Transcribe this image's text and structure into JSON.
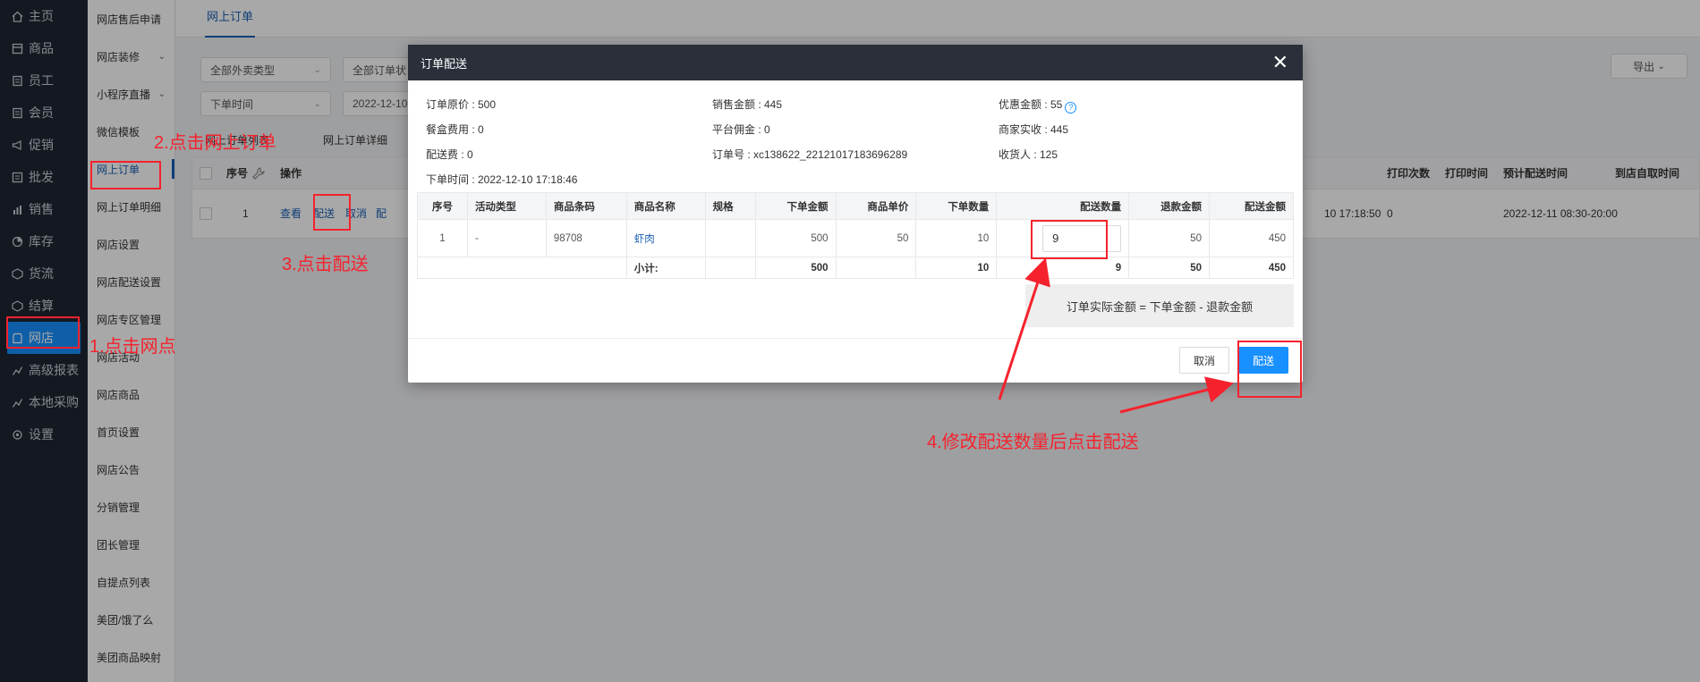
{
  "nav": {
    "items": [
      {
        "label": "主页",
        "icon": "home-icon"
      },
      {
        "label": "商品",
        "icon": "goods-icon"
      },
      {
        "label": "员工",
        "icon": "staff-icon"
      },
      {
        "label": "会员",
        "icon": "member-icon"
      },
      {
        "label": "促销",
        "icon": "promotion-icon"
      },
      {
        "label": "批发",
        "icon": "wholesale-icon"
      },
      {
        "label": "销售",
        "icon": "sales-icon"
      },
      {
        "label": "库存",
        "icon": "stock-icon"
      },
      {
        "label": "货流",
        "icon": "logistics-icon"
      },
      {
        "label": "结算",
        "icon": "settlement-icon"
      },
      {
        "label": "网店",
        "icon": "shop-icon",
        "active": true
      },
      {
        "label": "高级报表",
        "icon": "report-icon"
      },
      {
        "label": "本地采购",
        "icon": "purchase-icon"
      },
      {
        "label": "设置",
        "icon": "settings-icon"
      }
    ]
  },
  "subnav": {
    "items": [
      {
        "label": "网店售后申请"
      },
      {
        "label": "网店装修",
        "chevron": true
      },
      {
        "label": "小程序直播",
        "chevron": true
      },
      {
        "label": "微信模板"
      },
      {
        "label": "网上订单",
        "active": true
      },
      {
        "label": "网上订单明细"
      },
      {
        "label": "网店设置"
      },
      {
        "label": "网店配送设置"
      },
      {
        "label": "网店专区管理"
      },
      {
        "label": "网店活动"
      },
      {
        "label": "网店商品"
      },
      {
        "label": "首页设置"
      },
      {
        "label": "网店公告"
      },
      {
        "label": "分销管理"
      },
      {
        "label": "团长管理"
      },
      {
        "label": "自提点列表"
      },
      {
        "label": "美团/饿了么"
      },
      {
        "label": "美团商品映射"
      }
    ]
  },
  "topbar": {
    "tab": "网上订单"
  },
  "filters": {
    "type": "全部外卖类型",
    "status": "全部订单状",
    "time_field": "下单时间",
    "date": "2022-12-10"
  },
  "export_label": "导出",
  "subtabs": [
    "网上订单列表",
    "网上订单详细"
  ],
  "grid": {
    "headers": {
      "seq": "序号",
      "op": "操作",
      "print_count": "打印次数",
      "print_time": "打印时间",
      "deliver_time": "预计配送时间",
      "pickup_time": "到店自取时间"
    },
    "row": {
      "seq": "1",
      "actions": [
        "查看",
        "配送",
        "取消",
        "配"
      ],
      "time_tail": "10 17:18:50",
      "print_count": "0",
      "deliver_time": "2022-12-11 08:30-20:00"
    }
  },
  "modal": {
    "title": "订单配送",
    "info": {
      "orig_price": "订单原价 : 500",
      "sales_amount": "销售金额 : 445",
      "discount": "优惠金额 : 55",
      "box_fee": "餐盒费用 : 0",
      "platform_fee": "平台佣金 : 0",
      "merchant_income": "商家实收 : 445",
      "delivery_fee": "配送费 : 0",
      "order_no": "订单号 : xc138622_22121017183696289",
      "receiver": "收货人 : 125",
      "order_time": "下单时间 : 2022-12-10 17:18:46"
    },
    "table": {
      "headers": [
        "序号",
        "活动类型",
        "商品条码",
        "商品名称",
        "规格",
        "下单金额",
        "商品单价",
        "下单数量",
        "配送数量",
        "退款金额",
        "配送金额"
      ],
      "row": {
        "seq": "1",
        "activity": "-",
        "barcode": "98708",
        "name": "虾肉",
        "spec": "",
        "order_amount": "500",
        "unit_price": "50",
        "order_qty": "10",
        "deliver_qty": "9",
        "refund": "50",
        "deliver_amount": "450"
      },
      "subtotal": {
        "label": "小计:",
        "order_amount": "500",
        "order_qty": "10",
        "deliver_qty": "9",
        "refund": "50",
        "deliver_amount": "450"
      }
    },
    "note": "订单实际金额 = 下单金额 - 退款金额",
    "cancel": "取消",
    "confirm": "配送"
  },
  "annotations": {
    "step1": "1.点击网点",
    "step2": "2.点击网上订单",
    "step3": "3.点击配送",
    "step4": "4.修改配送数量后点击配送"
  },
  "colors": {
    "accent": "#1890ff",
    "annotation": "#f5222d",
    "nav_bg": "#1f2633"
  }
}
